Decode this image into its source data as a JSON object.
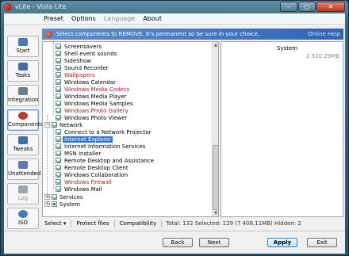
{
  "window": {
    "title": "vLite - Vista Lite",
    "minimize_glyph": "–",
    "maximize_glyph": "▢",
    "close_glyph": "✕"
  },
  "menu": {
    "items": [
      {
        "label": "Preset",
        "disabled": false
      },
      {
        "label": "Options",
        "disabled": false
      },
      {
        "label": "Language",
        "disabled": true
      },
      {
        "label": "About",
        "disabled": false
      }
    ]
  },
  "sidebar": {
    "items": [
      {
        "label": "Start",
        "icon": "start-icon",
        "color": "#4a7ab5"
      },
      {
        "label": "Tasks",
        "icon": "tasks-icon",
        "color": "#3b6ea8"
      },
      {
        "label": "Integration",
        "icon": "integration-icon",
        "color": "#6a7d8c"
      },
      {
        "label": "Components",
        "icon": "components-icon",
        "color": "#c0392b"
      },
      {
        "label": "Tweaks",
        "icon": "tweaks-icon",
        "color": "#3f6fb0"
      },
      {
        "label": "Unattended",
        "icon": "unattended-icon",
        "color": "#5a7ab0"
      },
      {
        "label": "Log",
        "icon": "log-icon",
        "color": "#9aa6b0"
      },
      {
        "label": "ISO",
        "icon": "iso-icon",
        "color": "#4a7ab5"
      }
    ],
    "active": "Components",
    "disabled": [
      "Log"
    ]
  },
  "banner": {
    "text": "Select components to REMOVE. It's permanent so be sure in your choice.",
    "help_link": "Online Help"
  },
  "tree": {
    "group1_items": [
      {
        "label": "Screensavers",
        "red": false
      },
      {
        "label": "Shell event sounds",
        "red": false
      },
      {
        "label": "SideShow",
        "red": false
      },
      {
        "label": "Sound Recorder",
        "red": false
      },
      {
        "label": "Wallpapers",
        "red": true
      },
      {
        "label": "Windows Calendar",
        "red": false
      },
      {
        "label": "Windows Media Codecs",
        "red": true
      },
      {
        "label": "Windows Media Player",
        "red": false
      },
      {
        "label": "Windows Media Samples",
        "red": false
      },
      {
        "label": "Windows Photo Gallery",
        "red": true
      },
      {
        "label": "Windows Photo Viewer",
        "red": false
      }
    ],
    "network_label": "Network",
    "network_items": [
      {
        "label": "Connect to a Network Projector",
        "red": false,
        "selected": false
      },
      {
        "label": "Internet Explorer",
        "red": false,
        "selected": true
      },
      {
        "label": "Internet Information Services",
        "red": false,
        "selected": false
      },
      {
        "label": "MSN Installer",
        "red": false,
        "selected": false
      },
      {
        "label": "Remote Desktop and Assistance",
        "red": false,
        "selected": false
      },
      {
        "label": "Remote Desktop Client",
        "red": false,
        "selected": false
      },
      {
        "label": "Windows Collaboration",
        "red": false,
        "selected": false
      },
      {
        "label": "Windows Firewall",
        "red": true,
        "selected": false
      },
      {
        "label": "Windows Mail",
        "red": false,
        "selected": false
      }
    ],
    "services_label": "Services",
    "system_label": "System",
    "expand_glyph": "+",
    "collapse_glyph": "−"
  },
  "info_panel": {
    "label": "System",
    "size": "2 520,29MB"
  },
  "status": {
    "select_label": "Select",
    "select_arrow": "▾",
    "protect_label": "Protect files",
    "compat_label": "Compatibility",
    "stats": "Total: 132   Selected: 129 (7 408,11MB)  Hidden: 2"
  },
  "buttons": {
    "back": "Back",
    "next": "Next",
    "apply": "Apply",
    "exit": "Exit"
  },
  "colors": {
    "red_item": "#c11e1e",
    "selected_bg": "#3276d2",
    "banner": "#3f74c0"
  }
}
